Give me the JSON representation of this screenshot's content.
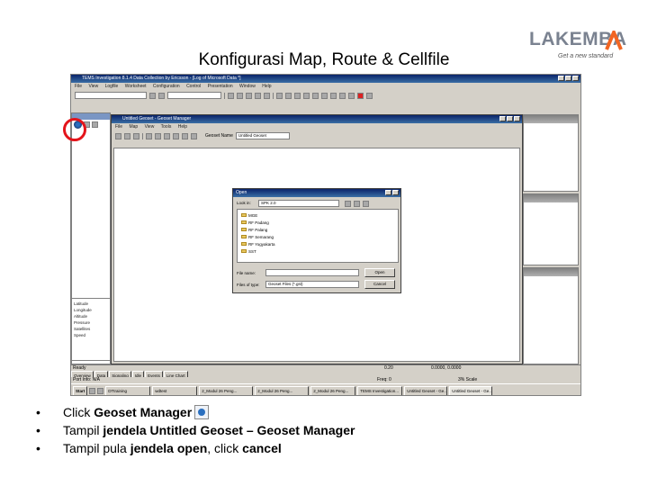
{
  "slide": {
    "title": "Konfigurasi Map, Route & Cellfile",
    "logo": {
      "wordmark": "LAKEMBA",
      "tagline": "Get a new standard"
    }
  },
  "app": {
    "title": "TEMS Investigation 8.1.4 Data Collection by Ericsson - [Log of Microsoft Data *]",
    "menu": [
      "File",
      "View",
      "Logfile",
      "Worksheet",
      "Configuration",
      "Control",
      "Presentation",
      "Window",
      "Help"
    ]
  },
  "geoset_manager": {
    "title": "Untitled Geoset - Geoset Manager",
    "menu": [
      "File",
      "Map",
      "View",
      "Tools",
      "Help"
    ],
    "geoset_name_label": "Geoset Name",
    "geoset_name_value": "Untitled Geoset"
  },
  "open_dialog": {
    "title": "Open",
    "look_in_label": "Look in:",
    "look_in_value": "SPK 2.0",
    "folders": [
      "MGE",
      "RF Padang",
      "RF Palang",
      "RF Semarang",
      "RF Yogyakarta",
      "SST"
    ],
    "file_name_label": "File name:",
    "file_name_value": "",
    "files_of_type_label": "Files of type:",
    "files_of_type_value": "Geoset Files (*.gst)",
    "open_button": "Open",
    "cancel_button": "Cancel"
  },
  "info_panel": {
    "lines": [
      "Latitude",
      "Longitude",
      "Altitude",
      "Pressure",
      "Satellites",
      "Speed"
    ]
  },
  "statusbar": {
    "ready": "Ready",
    "coord_a": "0.20",
    "coord_b": "0.0000, 0.0000",
    "tabs": [
      "Overview",
      "Data",
      "Signaling",
      "Idle",
      "Events",
      "Line Chart"
    ],
    "ports": "Port Info: N/A",
    "freq": "Freq: 0",
    "zoom": "3% Scale"
  },
  "taskbar": {
    "start": "Start",
    "items": [
      "DTtraining",
      "wdtest",
      "2_Modul 26 Peng...",
      "2_Modul 26 Peng...",
      "2_Modul 26 Peng...",
      "TEMS Investigation...",
      "Untitled Geoset - Ge...",
      "Untitled Geoset - Ge..."
    ]
  },
  "bullets": [
    {
      "prefix": "Click ",
      "bold": "Geoset Manager",
      "rest": "",
      "has_icon": true
    },
    {
      "prefix": "Tampil ",
      "bold": "jendela Untitled Geoset – Geoset Manager",
      "rest": "",
      "has_icon": false
    },
    {
      "prefix": "Tampil pula ",
      "bold": "jendela open",
      "rest": ", click ",
      "bold2": "cancel",
      "has_icon": false
    }
  ],
  "bullet_marker": "•",
  "colors": {
    "highlight": "#e4141b",
    "titlebar": "#0a246a",
    "accent": "#f26522"
  }
}
